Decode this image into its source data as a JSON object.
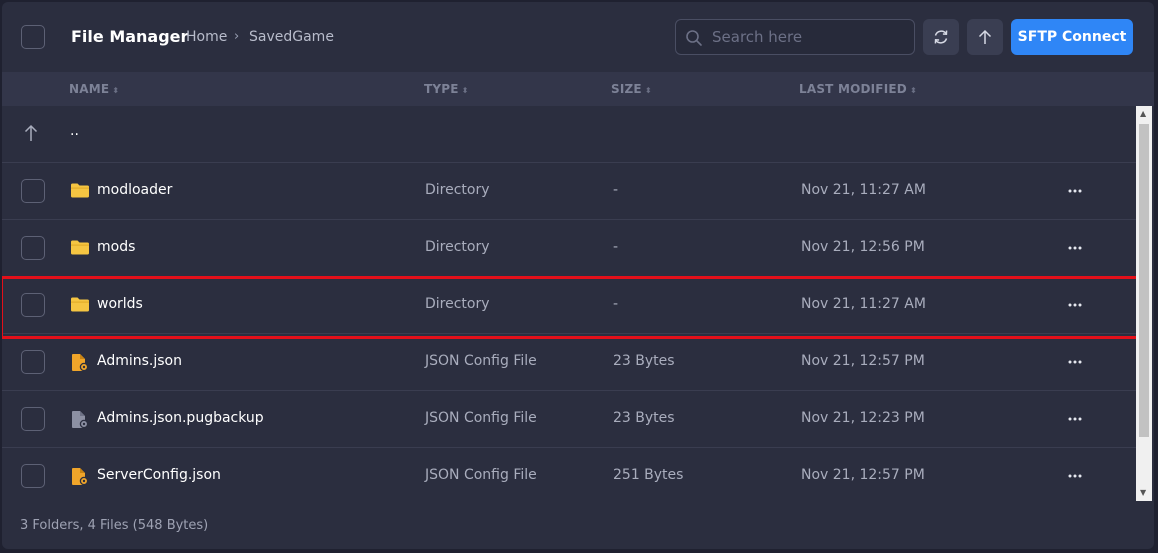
{
  "header": {
    "title": "File Manager",
    "breadcrumb": [
      "Home",
      "SavedGame"
    ],
    "search_placeholder": "Search here",
    "sftp_label": "SFTP Connect"
  },
  "columns": {
    "name": "NAME",
    "type": "TYPE",
    "size": "SIZE",
    "modified": "LAST MODIFIED"
  },
  "parent_row": {
    "label": ".."
  },
  "rows": [
    {
      "name": "modloader",
      "type": "Directory",
      "size": "-",
      "modified": "Nov 21, 11:27 AM",
      "icon": "folder-icon"
    },
    {
      "name": "mods",
      "type": "Directory",
      "size": "-",
      "modified": "Nov 21, 12:56 PM",
      "icon": "folder-icon"
    },
    {
      "name": "worlds",
      "type": "Directory",
      "size": "-",
      "modified": "Nov 21, 11:27 AM",
      "icon": "folder-icon"
    },
    {
      "name": "Admins.json",
      "type": "JSON Config File",
      "size": "23 Bytes",
      "modified": "Nov 21, 12:57 PM",
      "icon": "config-file-icon"
    },
    {
      "name": "Admins.json.pugbackup",
      "type": "JSON Config File",
      "size": "23 Bytes",
      "modified": "Nov 21, 12:23 PM",
      "icon": "config-file-icon"
    },
    {
      "name": "ServerConfig.json",
      "type": "JSON Config File",
      "size": "251 Bytes",
      "modified": "Nov 21, 12:57 PM",
      "icon": "config-file-icon"
    }
  ],
  "footer": {
    "summary": "3 Folders, 4 Files (548 Bytes)"
  },
  "colors": {
    "accent": "#2f86f6",
    "folder": "#f5c542",
    "config_file": "#f0a52a",
    "backup_file": "#8c90a3",
    "highlight": "#e3101a"
  }
}
